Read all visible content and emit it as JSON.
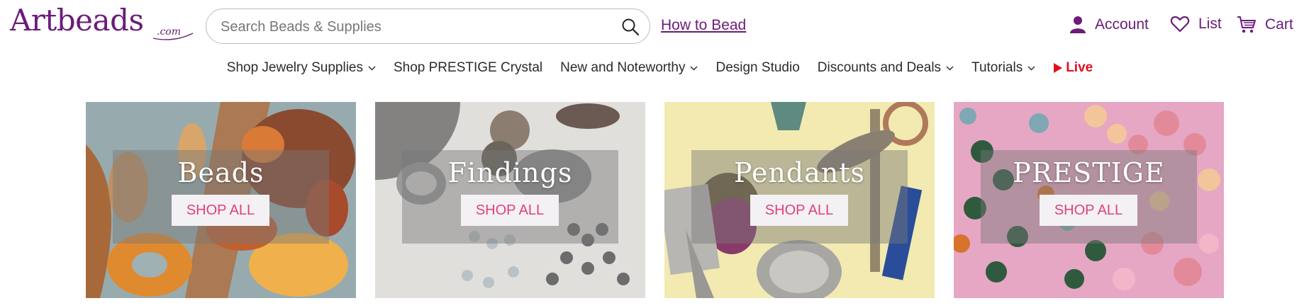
{
  "header": {
    "logo_text": "Artbeads",
    "logo_suffix": ".com",
    "search_placeholder": "Search Beads & Supplies",
    "search_icon": "search-icon",
    "how_to_link": "How to Bead",
    "account_label": "Account",
    "list_label": "List",
    "cart_label": "Cart",
    "brand_color": "#6b1b7a"
  },
  "nav": {
    "items": [
      {
        "label": "Shop Jewelry Supplies",
        "has_dropdown": true
      },
      {
        "label": "Shop PRESTIGE Crystal",
        "has_dropdown": false
      },
      {
        "label": "New and Noteworthy",
        "has_dropdown": true
      },
      {
        "label": "Design Studio",
        "has_dropdown": false
      },
      {
        "label": "Discounts and Deals",
        "has_dropdown": true
      },
      {
        "label": "Tutorials",
        "has_dropdown": true
      }
    ],
    "live_label": "Live",
    "live_color": "#e01020"
  },
  "tiles": [
    {
      "title": "Beads",
      "button": "SHOP ALL"
    },
    {
      "title": "Findings",
      "button": "SHOP ALL"
    },
    {
      "title": "Pendants",
      "button": "SHOP ALL"
    },
    {
      "title": "PRESTIGE",
      "button": "SHOP ALL"
    }
  ],
  "button_text_color": "#e0407f"
}
